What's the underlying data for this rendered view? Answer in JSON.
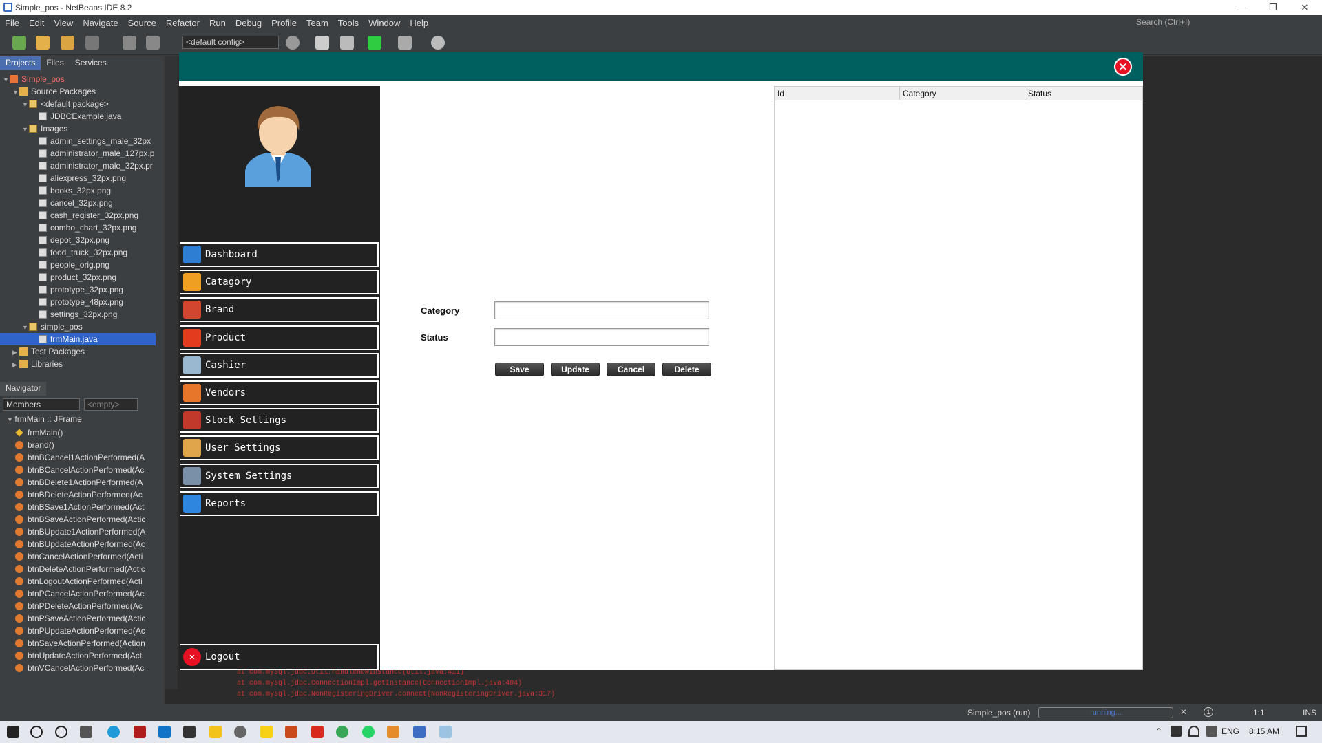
{
  "window": {
    "title": "Simple_pos - NetBeans IDE 8.2",
    "min": "—",
    "max": "❐",
    "close": "✕"
  },
  "menu": [
    "File",
    "Edit",
    "View",
    "Navigate",
    "Source",
    "Refactor",
    "Run",
    "Debug",
    "Profile",
    "Team",
    "Tools",
    "Window",
    "Help"
  ],
  "search": {
    "placeholder": "Search (Ctrl+I)"
  },
  "toolbar": {
    "config": "<default config>"
  },
  "projects_tabs": [
    "Projects",
    "Files",
    "Services"
  ],
  "project_tree": [
    {
      "label": "Simple_pos",
      "indent": 0,
      "type": "project",
      "toggle": "▼"
    },
    {
      "label": "Source Packages",
      "indent": 1,
      "type": "folder",
      "toggle": "▼"
    },
    {
      "label": "<default package>",
      "indent": 2,
      "type": "pkg",
      "toggle": "▼"
    },
    {
      "label": "JDBCExample.java",
      "indent": 3,
      "type": "file",
      "toggle": ""
    },
    {
      "label": "Images",
      "indent": 2,
      "type": "pkg",
      "toggle": "▼"
    },
    {
      "label": "admin_settings_male_32px",
      "indent": 3,
      "type": "file",
      "toggle": ""
    },
    {
      "label": "administrator_male_127px.p",
      "indent": 3,
      "type": "file",
      "toggle": ""
    },
    {
      "label": "administrator_male_32px.pr",
      "indent": 3,
      "type": "file",
      "toggle": ""
    },
    {
      "label": "aliexpress_32px.png",
      "indent": 3,
      "type": "file",
      "toggle": ""
    },
    {
      "label": "books_32px.png",
      "indent": 3,
      "type": "file",
      "toggle": ""
    },
    {
      "label": "cancel_32px.png",
      "indent": 3,
      "type": "file",
      "toggle": ""
    },
    {
      "label": "cash_register_32px.png",
      "indent": 3,
      "type": "file",
      "toggle": ""
    },
    {
      "label": "combo_chart_32px.png",
      "indent": 3,
      "type": "file",
      "toggle": ""
    },
    {
      "label": "depot_32px.png",
      "indent": 3,
      "type": "file",
      "toggle": ""
    },
    {
      "label": "food_truck_32px.png",
      "indent": 3,
      "type": "file",
      "toggle": ""
    },
    {
      "label": "people_orig.png",
      "indent": 3,
      "type": "file",
      "toggle": ""
    },
    {
      "label": "product_32px.png",
      "indent": 3,
      "type": "file",
      "toggle": ""
    },
    {
      "label": "prototype_32px.png",
      "indent": 3,
      "type": "file",
      "toggle": ""
    },
    {
      "label": "prototype_48px.png",
      "indent": 3,
      "type": "file",
      "toggle": ""
    },
    {
      "label": "settings_32px.png",
      "indent": 3,
      "type": "file",
      "toggle": ""
    },
    {
      "label": "simple_pos",
      "indent": 2,
      "type": "pkg",
      "toggle": "▼"
    },
    {
      "label": "frmMain.java",
      "indent": 3,
      "type": "file",
      "toggle": "",
      "selected": true
    },
    {
      "label": "Test Packages",
      "indent": 1,
      "type": "folder",
      "toggle": "▶"
    },
    {
      "label": "Libraries",
      "indent": 1,
      "type": "folder",
      "toggle": "▶"
    }
  ],
  "navigator": {
    "tab": "Navigator",
    "members_label": "Members",
    "filter": "<empty>",
    "root": "frmMain :: JFrame",
    "members": [
      "frmMain()",
      "brand()",
      "btnBCancel1ActionPerformed(A",
      "btnBCancelActionPerformed(Ac",
      "btnBDelete1ActionPerformed(A",
      "btnBDeleteActionPerformed(Ac",
      "btnBSave1ActionPerformed(Act",
      "btnBSaveActionPerformed(Actic",
      "btnBUpdate1ActionPerformed(A",
      "btnBUpdateActionPerformed(Ac",
      "btnCancelActionPerformed(Acti",
      "btnDeleteActionPerformed(Actic",
      "btnLogoutActionPerformed(Acti",
      "btnPCancelActionPerformed(Ac",
      "btnPDeleteActionPerformed(Ac",
      "btnPSaveActionPerformed(Actic",
      "btnPUpdateActionPerformed(Ac",
      "btnSaveActionPerformed(Action",
      "btnUpdateActionPerformed(Acti",
      "btnVCancelActionPerformed(Ac"
    ]
  },
  "output_lines": [
    "at com.mysql.jdbc.Util.handleNewInstance(Util.java:411)",
    "at com.mysql.jdbc.ConnectionImpl.getInstance(ConnectionImpl.java:404)",
    "at com.mysql.jdbc.NonRegisteringDriver.connect(NonRegisteringDriver.java:317)"
  ],
  "status": {
    "run_label": "Simple_pos (run)",
    "progress": "running...",
    "position": "1:1",
    "mode": "INS",
    "notif": "1"
  },
  "taskbar": {
    "lang": "ENG",
    "time": "8:15 AM"
  },
  "app": {
    "close": "✕",
    "menu": [
      {
        "label": "Dashboard",
        "color": "#2e7fd4"
      },
      {
        "label": "Catagory",
        "color": "#f0a020"
      },
      {
        "label": "Brand",
        "color": "#d2452f"
      },
      {
        "label": "Product",
        "color": "#e23b1e"
      },
      {
        "label": "Cashier",
        "color": "#9ab8d0"
      },
      {
        "label": "Vendors",
        "color": "#e8762a"
      },
      {
        "label": "Stock Settings",
        "color": "#c0392b"
      },
      {
        "label": "User Settings",
        "color": "#e0a54a"
      },
      {
        "label": "System Settings",
        "color": "#7a8fa8"
      },
      {
        "label": "Reports",
        "color": "#2e86de"
      }
    ],
    "logout": "Logout",
    "form": {
      "category_label": "Category",
      "status_label": "Status",
      "category_value": "",
      "status_value": "",
      "buttons": [
        "Save",
        "Update",
        "Cancel",
        "Delete"
      ]
    },
    "table": {
      "columns": [
        "Id",
        "Category",
        "Status"
      ],
      "rows": []
    }
  },
  "colors": {
    "header": "#005f5f",
    "sidebar": "#222222",
    "close": "#e81123"
  }
}
